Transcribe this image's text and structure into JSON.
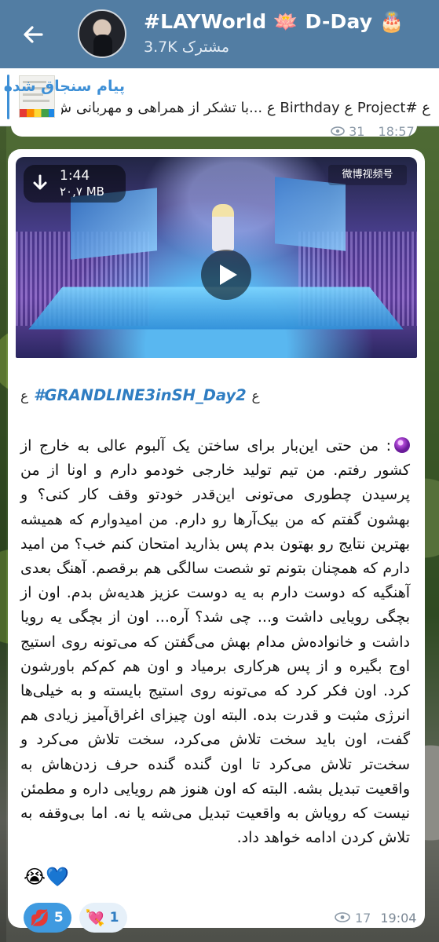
{
  "header": {
    "title": "#LAYWorld 🪷 D-Day 🎂",
    "subscribers": "3.7K مشترک"
  },
  "pinned": {
    "label": "پیام سنجاق شده",
    "preview": "ﻉ #Project ﻉ Birthday ﻉ ...با تشکر از همراهی و مهربانی ش"
  },
  "prev_message": {
    "views": "31",
    "time": "18:57"
  },
  "post": {
    "video": {
      "duration": "1:44",
      "size": "۲۰,۷ MB",
      "watermark": "微博视频号"
    },
    "hashtag": "#GRANDLINE3inSH_Day2",
    "hashtag_glyph_left": "ﻉ",
    "hashtag_glyph_right": "ﻉ",
    "text": ": من حتی این‌بار برای ساختن یک آلبوم عالی به خارج از کشور رفتم. من تیم تولید خارجی خودمو دارم و اونا از من پرسیدن چطوری می‌تونی این‌قدر خودتو وقف کار کنی؟ و بهشون گفتم که من بیک‌آرها رو دارم. من امیدوارم که همیشه بهترین نتایج رو بهتون بدم پس بذارید امتحان کنم خب؟ من امید دارم که همچنان بتونم تو شصت سالگی هم برقصم. آهنگ بعدی آهنگیه که دوست دارم به یه دوست عزیز هدیه‌ش بدم. اون از بچگی رویایی داشت و... چی شد؟ آره... اون از بچگی یه رویا داشت و خانواده‌ش مدام بهش می‌گفتن که می‌تونه روی استیج اوج بگیره و از پس هرکاری برمیاد و اون هم کم‌کم باورشون کرد. اون فکر کرد که می‌تونه روی استیج بایسته و به خیلی‌ها انرژی مثبت و قدرت بده. البته اون چیزای اغراق‌آمیز زیادی هم گفت، اون باید سخت تلاش می‌کرد، سخت تلاش می‌کرد و سخت‌تر تلاش می‌کرد تا اون گنده گنده حرف زدن‌هاش به واقعیت تبدیل بشه. البته که اون هنوز هم رویایی داره و مطمئن نیست که رویاش به واقعیت تبدیل می‌شه یا نه. اما بی‌وقفه به تلاش کردن ادامه خواهد داد.",
    "end_emojis": "😭💙",
    "reactions": [
      {
        "emoji": "💋",
        "count": "5",
        "active": true
      },
      {
        "emoji": "💘",
        "count": "1",
        "active": false
      }
    ],
    "views": "17",
    "time": "19:04"
  },
  "colors": {
    "header_bg": "#527da3",
    "accent": "#3d8fd6",
    "link": "#2f7dc2",
    "reaction_active": "#3f9ae0"
  }
}
